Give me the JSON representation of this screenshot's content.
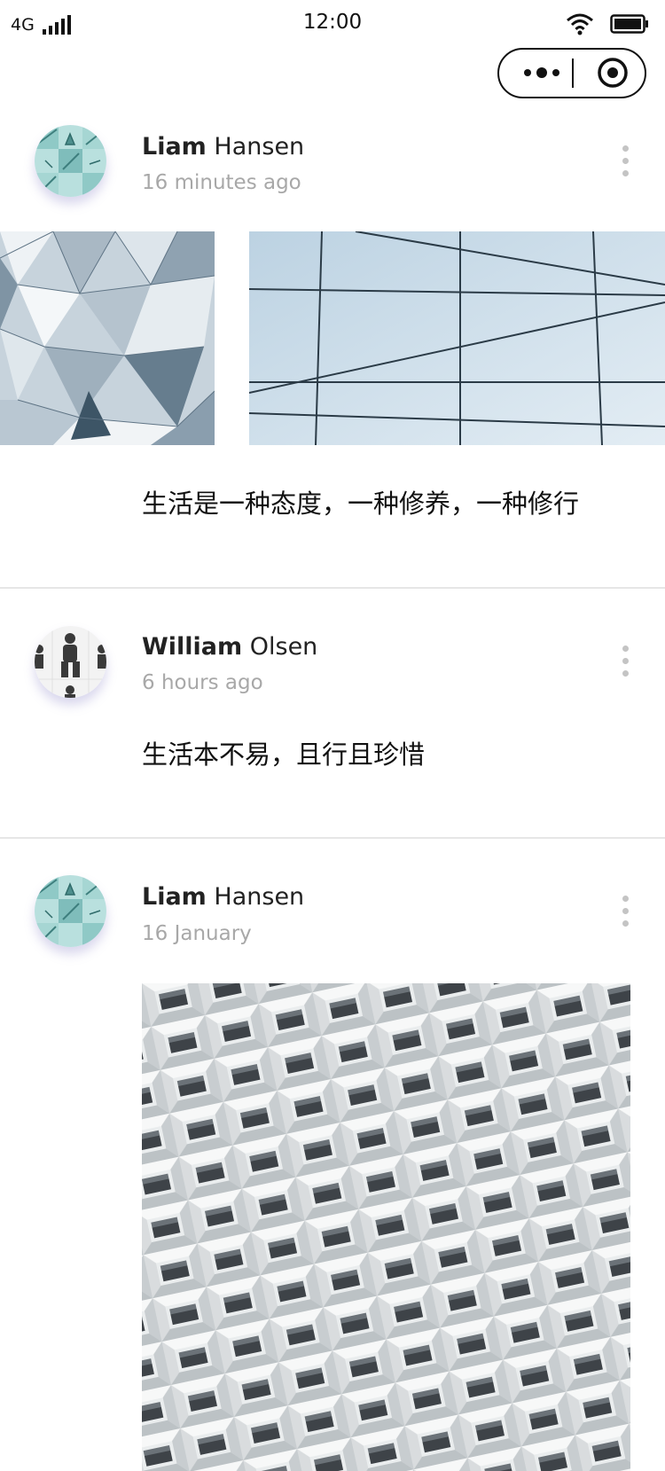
{
  "status_bar": {
    "network": "4G",
    "time": "12:00"
  },
  "capsule": {
    "more_icon": "more-dots-icon",
    "close_icon": "target-close-icon"
  },
  "posts": [
    {
      "author_first": "Liam",
      "author_last": "Hansen",
      "time": "16 minutes ago",
      "caption": "生活是一种态度，一种修养，一种修行",
      "images": [
        "geometric-facade-photo",
        "glass-ceiling-photo"
      ]
    },
    {
      "author_first": "William",
      "author_last": "Olsen",
      "time": "6 hours ago",
      "caption": "生活本不易，且行且珍惜",
      "images": []
    },
    {
      "author_first": "Liam",
      "author_last": "Hansen",
      "time": "16 January",
      "caption": "",
      "images": [
        "white-lattice-facade-photo"
      ]
    }
  ],
  "colors": {
    "text": "#111111",
    "muted": "#a8a8a8",
    "divider": "#e6e6e6",
    "kebab": "#c4c4c4",
    "avatar_shadow": "#786ebe"
  }
}
